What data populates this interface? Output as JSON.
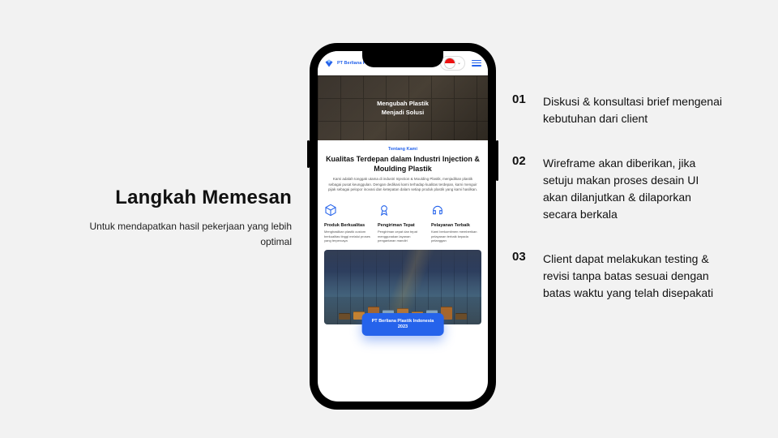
{
  "left": {
    "title": "Langkah Memesan",
    "subtitle": "Untuk mendapatkan hasil pekerjaan yang lebih optimal"
  },
  "phone": {
    "brand": "PT Berliana Plastik Indonesia",
    "hero": {
      "line1": "Mengubah Plastik",
      "line2": "Menjadi Solusi"
    },
    "about": {
      "eyebrow": "Tentang Kami",
      "heading": "Kualitas Terdepan dalam Industri Injection & Moulding Plastik",
      "body": "Kami adalah tonggak utama di industri Injection & Moulding Plastik, menjadikan plastik sebagai pusat keunggulan. Dengan dedikasi kami terhadap kualitas terdepan, kami menguir pijak sebagai pelopor inovasi dan ketepatan dalam setiap produk plastik yang kami hasilkan."
    },
    "features": [
      {
        "title": "Produk Berkualitas",
        "text": "Menghasilkan plastik custom berkualitas tinggi melalui proses yang terpercaya"
      },
      {
        "title": "Pengiriman Tepat",
        "text": "Pengiriman cepat dan tepat menggunakan layanan pengantaran mandiri"
      },
      {
        "title": "Pelayanan Terbaik",
        "text": "Kami berkomitmen memberikan pelayanan terbaik kepada pelanggan"
      }
    ],
    "cta": {
      "line1": "PT Berliana Plastik Indonesia",
      "line2": "2023"
    }
  },
  "steps": [
    {
      "num": "01",
      "text": "Diskusi & konsultasi brief mengenai kebutuhan dari client"
    },
    {
      "num": "02",
      "text": "Wireframe akan diberikan, jika setuju makan proses desain UI akan dilanjutkan & dilaporkan secara berkala"
    },
    {
      "num": "03",
      "text": "Client dapat melakukan testing & revisi tanpa batas sesuai dengan batas waktu yang telah disepakati"
    }
  ]
}
